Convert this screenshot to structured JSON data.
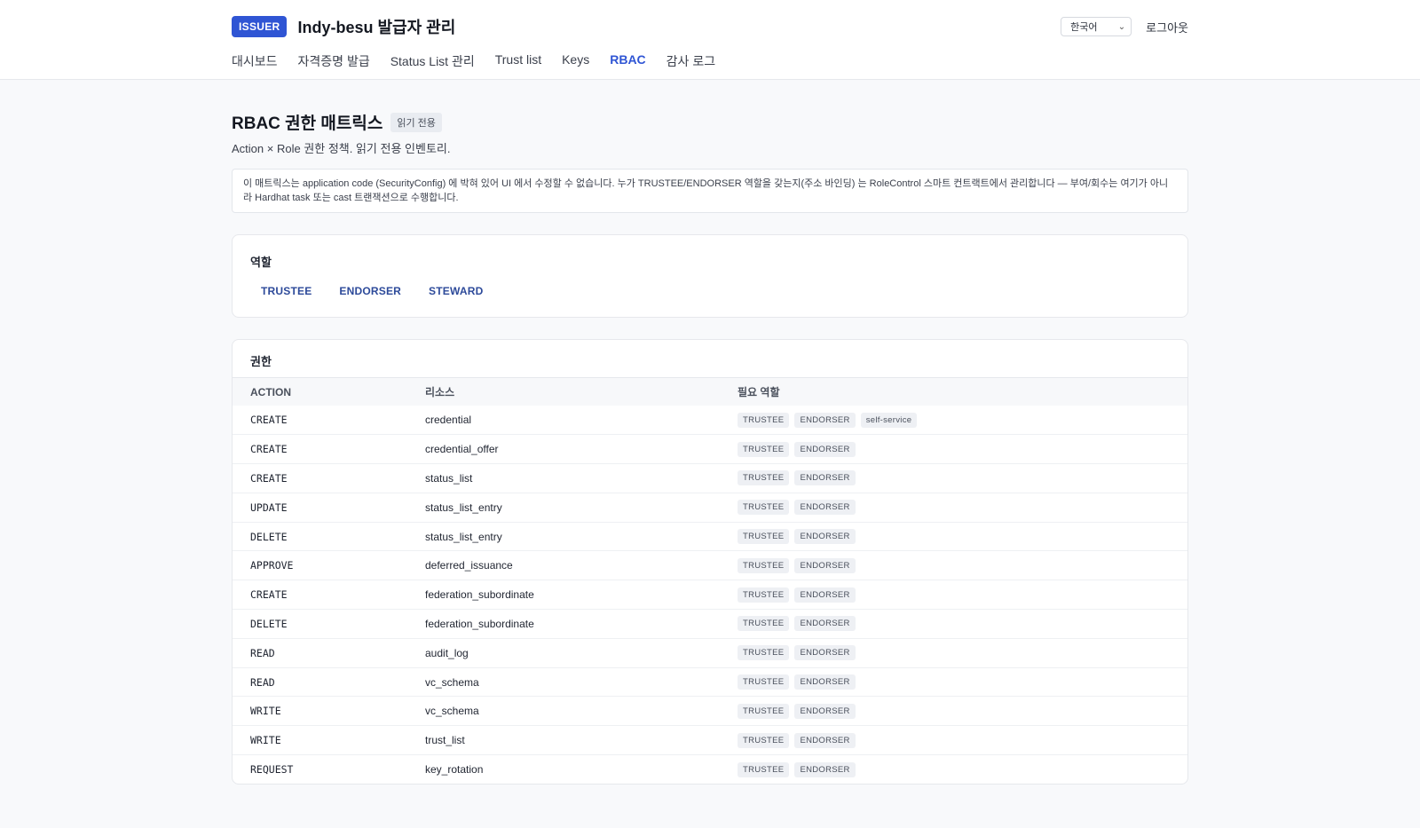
{
  "header": {
    "badge": "ISSUER",
    "title": "Indy-besu 발급자 관리",
    "language": "한국어",
    "logout": "로그아웃",
    "nav": [
      {
        "label": "대시보드",
        "active": false
      },
      {
        "label": "자격증명 발급",
        "active": false
      },
      {
        "label": "Status List 관리",
        "active": false
      },
      {
        "label": "Trust list",
        "active": false
      },
      {
        "label": "Keys",
        "active": false
      },
      {
        "label": "RBAC",
        "active": true
      },
      {
        "label": "감사 로그",
        "active": false
      }
    ]
  },
  "page": {
    "title": "RBAC 권한 매트릭스",
    "readonly_tag": "읽기 전용",
    "subtitle": "Action × Role 권한 정책. 읽기 전용 인벤토리.",
    "notice": "이 매트릭스는 application code (SecurityConfig) 에 박혀 있어 UI 에서 수정할 수 없습니다. 누가 TRUSTEE/ENDORSER 역할을 갖는지(주소 바인딩) 는 RoleControl 스마트 컨트랙트에서 관리합니다 — 부여/회수는 여기가 아니라 Hardhat task 또는 cast 트랜잭션으로 수행합니다."
  },
  "roles": {
    "title": "역할",
    "items": [
      "TRUSTEE",
      "ENDORSER",
      "STEWARD"
    ]
  },
  "permissions": {
    "title": "권한",
    "columns": [
      "ACTION",
      "리소스",
      "필요 역할"
    ],
    "rows": [
      {
        "action": "CREATE",
        "resource": "credential",
        "roles": [
          "TRUSTEE",
          "ENDORSER",
          "self-service"
        ]
      },
      {
        "action": "CREATE",
        "resource": "credential_offer",
        "roles": [
          "TRUSTEE",
          "ENDORSER"
        ]
      },
      {
        "action": "CREATE",
        "resource": "status_list",
        "roles": [
          "TRUSTEE",
          "ENDORSER"
        ]
      },
      {
        "action": "UPDATE",
        "resource": "status_list_entry",
        "roles": [
          "TRUSTEE",
          "ENDORSER"
        ]
      },
      {
        "action": "DELETE",
        "resource": "status_list_entry",
        "roles": [
          "TRUSTEE",
          "ENDORSER"
        ]
      },
      {
        "action": "APPROVE",
        "resource": "deferred_issuance",
        "roles": [
          "TRUSTEE",
          "ENDORSER"
        ]
      },
      {
        "action": "CREATE",
        "resource": "federation_subordinate",
        "roles": [
          "TRUSTEE",
          "ENDORSER"
        ]
      },
      {
        "action": "DELETE",
        "resource": "federation_subordinate",
        "roles": [
          "TRUSTEE",
          "ENDORSER"
        ]
      },
      {
        "action": "READ",
        "resource": "audit_log",
        "roles": [
          "TRUSTEE",
          "ENDORSER"
        ]
      },
      {
        "action": "READ",
        "resource": "vc_schema",
        "roles": [
          "TRUSTEE",
          "ENDORSER"
        ]
      },
      {
        "action": "WRITE",
        "resource": "vc_schema",
        "roles": [
          "TRUSTEE",
          "ENDORSER"
        ]
      },
      {
        "action": "WRITE",
        "resource": "trust_list",
        "roles": [
          "TRUSTEE",
          "ENDORSER"
        ]
      },
      {
        "action": "REQUEST",
        "resource": "key_rotation",
        "roles": [
          "TRUSTEE",
          "ENDORSER"
        ]
      }
    ]
  }
}
